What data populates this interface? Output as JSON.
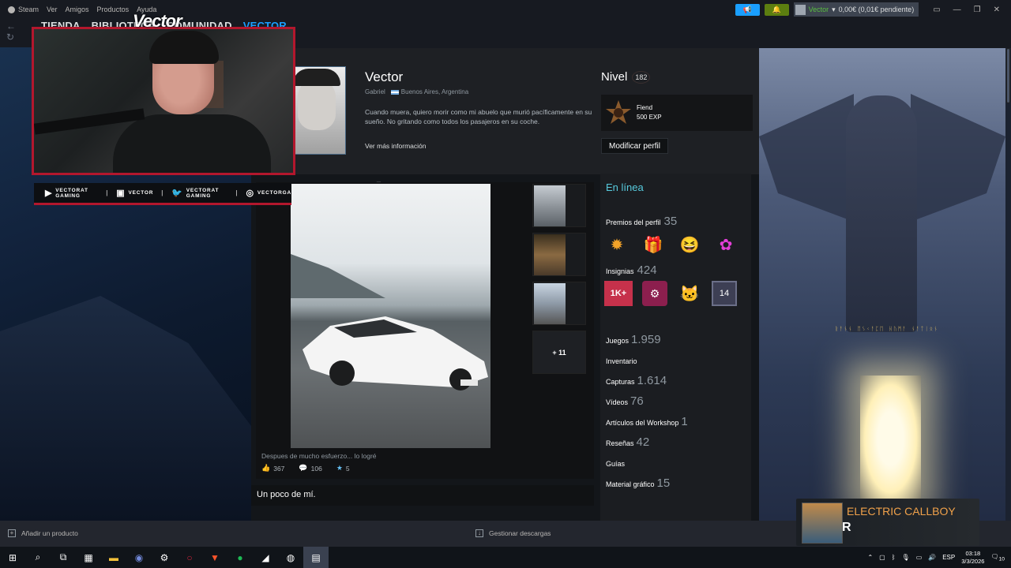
{
  "menubar": {
    "items": [
      "Steam",
      "Ver",
      "Amigos",
      "Productos",
      "Ayuda"
    ]
  },
  "topright": {
    "account_name": "Vector",
    "balance": "0,00€ (0,01€ pendiente)"
  },
  "nav": {
    "links": [
      "TIENDA",
      "BIBLIOTECA",
      "COMUNIDAD",
      "VECTOR"
    ]
  },
  "overlay": {
    "cam_title": "Vector",
    "social": [
      {
        "icon": "youtube-icon",
        "label": "VECTORAT GAMING"
      },
      {
        "icon": "twitch-icon",
        "label": "VECTOR"
      },
      {
        "icon": "twitter-icon",
        "label": "VECTORAT GAMING"
      },
      {
        "icon": "instagram-icon",
        "label": "VECTORGA"
      }
    ]
  },
  "profile": {
    "name": "Vector",
    "real_name": "Gabriel",
    "location": "Buenos Aires, Argentina",
    "summary": "Cuando muera, quiero morir como mi abuelo que murió pacíficamente en su sueño. No gritando como todos los pasajeros en su coche.",
    "more_info": "Ver más información",
    "level_label": "Nivel",
    "level": "182",
    "badge_name": "Fiend",
    "badge_xp": "500 EXP",
    "edit_button": "Modificar perfil"
  },
  "showcase": {
    "caption": "Despues de mucho esfuerzo... lo logré",
    "likes": "367",
    "comments": "106",
    "awards": "5",
    "more_count": "+ 11",
    "about_title": "Un poco de mí."
  },
  "sidebar": {
    "status": "En línea",
    "awards_label": "Premios del perfil",
    "awards_count": "35",
    "badges_label": "Insignias",
    "badges_count": "424",
    "badge_icons": [
      "1K+",
      "steam-2025",
      "cat",
      "14"
    ],
    "stats": [
      {
        "label": "Juegos",
        "count": "1.959"
      },
      {
        "label": "Inventario",
        "count": ""
      },
      {
        "label": "Capturas",
        "count": "1.614"
      },
      {
        "label": "Vídeos",
        "count": "76"
      },
      {
        "label": "Artículos del Workshop",
        "count": "1"
      },
      {
        "label": "Reseñas",
        "count": "42"
      },
      {
        "label": "Guías",
        "count": ""
      },
      {
        "label": "Material gráfico",
        "count": "15"
      }
    ]
  },
  "bottombar": {
    "add_product": "Añadir un producto",
    "downloads": "Gestionar descargas"
  },
  "music": {
    "band": "ELECTRIC CALLBOY",
    "sub": "R"
  },
  "right_bg": {
    "runes": "ᚱᚨᚾᚾ ᛖᛊᚲᚨᛈᛖ ᚺᚢᛗᚨ ᚾᚨᛏᛁᛟᚾ"
  },
  "taskbar": {
    "lang": "ESP",
    "time": "03:18",
    "date": "3/3/2026",
    "notif": "10"
  }
}
